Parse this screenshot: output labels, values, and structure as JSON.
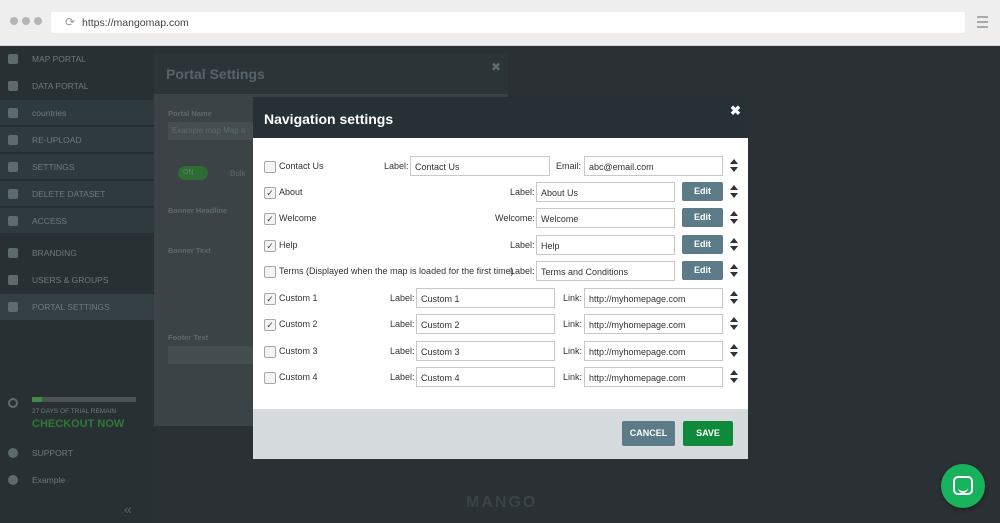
{
  "browser": {
    "url": "https://mangomap.com"
  },
  "sidebar": {
    "items": [
      {
        "label": "MAP PORTAL",
        "icon": "globe-icon"
      },
      {
        "label": "DATA PORTAL",
        "icon": "table-icon"
      },
      {
        "label": "countries",
        "icon": "grid-icon"
      },
      {
        "label": "RE-UPLOAD",
        "icon": "upload-icon"
      },
      {
        "label": "SETTINGS",
        "icon": "gear-icon"
      },
      {
        "label": "DELETE DATASET",
        "icon": "trash-icon"
      },
      {
        "label": "ACCESS",
        "icon": "lock-icon"
      },
      {
        "label": "BRANDING",
        "icon": "palette-icon"
      },
      {
        "label": "USERS & GROUPS",
        "icon": "users-icon"
      },
      {
        "label": "PORTAL SETTINGS",
        "icon": "monitor-icon"
      }
    ],
    "trial_text": "27 DAYS OF TRIAL REMAIN",
    "trial_progress": 0.1,
    "checkout_label": "CHECKOUT NOW",
    "support_label": "SUPPORT",
    "example_label": "Example"
  },
  "bg_panel": {
    "title": "Portal Settings",
    "portal_name_label": "Portal Name",
    "portal_name_value": "Example map Map a",
    "toggle_label": "ON",
    "toggle_text": "Bulk",
    "banner_headline_label": "Banner Headline",
    "banner_text_label": "Banner Text",
    "footer_text_label": "Footer Text",
    "logo_text": "MANGO"
  },
  "modal": {
    "title": "Navigation settings",
    "rows": [
      {
        "name": "Contact Us",
        "checked": false,
        "label_name": "Label:",
        "value": "Contact Us",
        "extra_label": "Email:",
        "extra_value": "abc@email.com",
        "edit": ""
      },
      {
        "name": "About",
        "checked": true,
        "label_name": "Label:",
        "value": "About Us",
        "extra_label": "",
        "extra_value": "",
        "edit": "Edit"
      },
      {
        "name": "Welcome",
        "checked": true,
        "label_name": "Welcome:",
        "value": "Welcome",
        "extra_label": "",
        "extra_value": "",
        "edit": "Edit"
      },
      {
        "name": "Help",
        "checked": true,
        "label_name": "Label:",
        "value": "Help",
        "extra_label": "",
        "extra_value": "",
        "edit": "Edit"
      },
      {
        "name": "Terms (Displayed when the map is loaded for the first time)",
        "checked": false,
        "label_name": "Label:",
        "value": "Terms and Conditions",
        "extra_label": "",
        "extra_value": "",
        "edit": "Edit"
      },
      {
        "name": "Custom 1",
        "checked": true,
        "label_name": "Label:",
        "value": "Custom 1",
        "extra_label": "Link:",
        "extra_value": "http://myhomepage.com",
        "edit": ""
      },
      {
        "name": "Custom 2",
        "checked": true,
        "label_name": "Label:",
        "value": "Custom 2",
        "extra_label": "Link:",
        "extra_value": "http://myhomepage.com",
        "edit": ""
      },
      {
        "name": "Custom 3",
        "checked": false,
        "label_name": "Label:",
        "value": "Custom 3",
        "extra_label": "Link:",
        "extra_value": "http://myhomepage.com",
        "edit": ""
      },
      {
        "name": "Custom 4",
        "checked": false,
        "label_name": "Label:",
        "value": "Custom 4",
        "extra_label": "Link:",
        "extra_value": "http://myhomepage.com",
        "edit": ""
      }
    ],
    "cancel_label": "CANCEL",
    "save_label": "SAVE",
    "close_icon": "close-icon",
    "check_glyph": "✓"
  },
  "colors": {
    "accent_green": "#0f8a3a",
    "edit_gray": "#5b7b88",
    "modal_header": "#273034",
    "chat_green": "#17b25b"
  }
}
